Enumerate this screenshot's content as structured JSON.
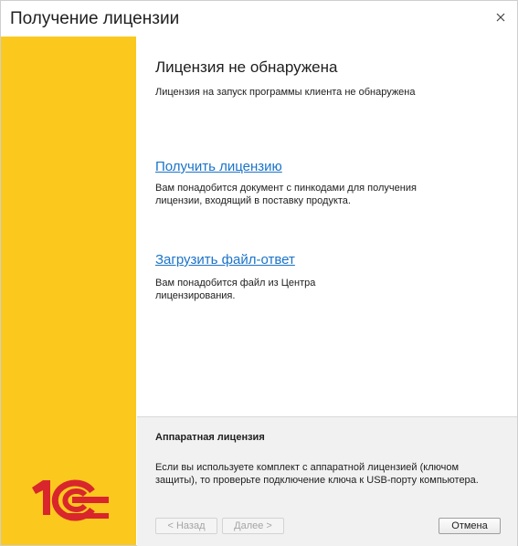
{
  "window": {
    "title": "Получение лицензии",
    "close_icon": "close-icon"
  },
  "sidebar": {
    "logo_text": "1С",
    "logo_colors": {
      "red": "#d8262c",
      "yellow": "#fbc81e"
    }
  },
  "main": {
    "heading": "Лицензия не обнаружена",
    "subtitle": "Лицензия на запуск программы клиента не обнаружена",
    "get_license": {
      "link": "Получить лицензию",
      "description": "Вам понадобится документ с пинкодами для получения лицензии, входящий в поставку продукта."
    },
    "upload_file": {
      "link": "Загрузить файл-ответ",
      "description": "Вам понадобится файл из Центра лицензирования."
    }
  },
  "footer": {
    "hardware_title": "Аппаратная лицензия",
    "hardware_text": "Если вы используете комплект с аппаратной лицензией (ключом защиты), то проверьте подключение ключа к USB-порту компьютера.",
    "buttons": {
      "back": "< Назад",
      "next": "Далее >",
      "cancel": "Отмена"
    }
  },
  "colors": {
    "sidebar_yellow": "#fbc81e",
    "link_blue": "#1a73c9",
    "footer_gray": "#f1f1f1"
  }
}
